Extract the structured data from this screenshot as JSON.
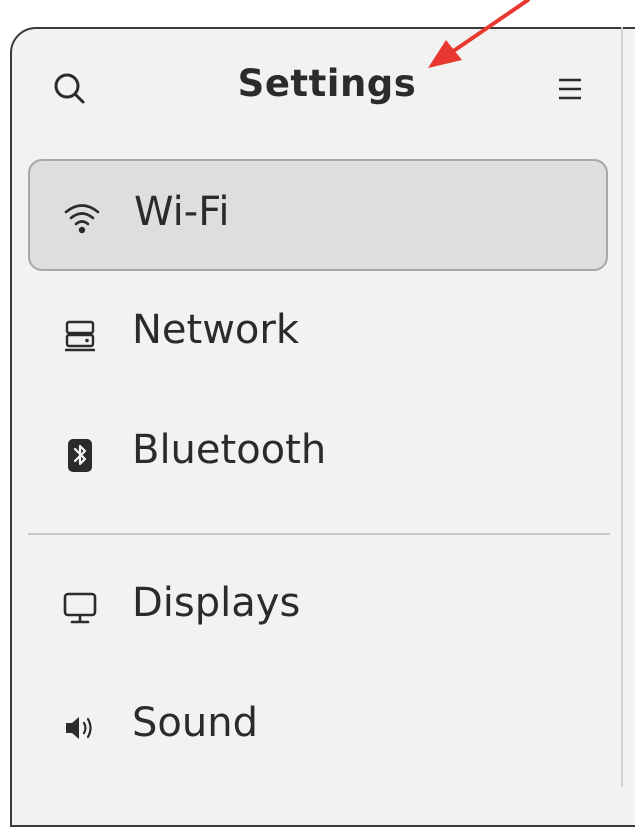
{
  "header": {
    "title": "Settings",
    "search_icon": "search-icon",
    "menu_icon": "hamburger-menu-icon"
  },
  "sidebar": {
    "items": [
      {
        "label": "Wi-Fi",
        "icon": "wifi-icon",
        "selected": true
      },
      {
        "label": "Network",
        "icon": "network-icon",
        "selected": false
      },
      {
        "label": "Bluetooth",
        "icon": "bluetooth-icon",
        "selected": false
      },
      {
        "label": "Displays",
        "icon": "display-icon",
        "selected": false
      },
      {
        "label": "Sound",
        "icon": "speaker-icon",
        "selected": false
      }
    ]
  },
  "colors": {
    "window_bg": "#f2f2f2",
    "selected_bg": "#dedede",
    "text": "#2b2b2b",
    "annotation_arrow": "#e8382f"
  }
}
